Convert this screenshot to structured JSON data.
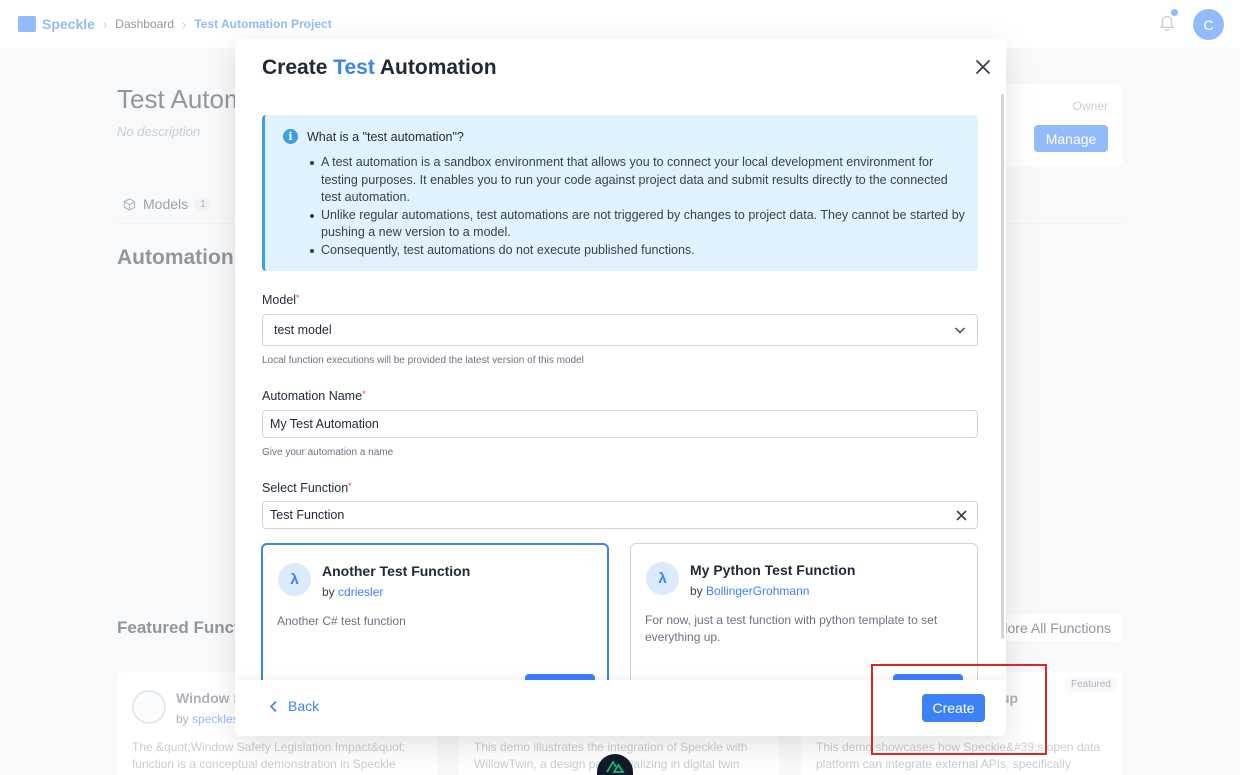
{
  "topbar": {
    "brand": "Speckle",
    "breadcrumb": [
      "Dashboard",
      "Test Automation Project"
    ],
    "avatar_initial": "C"
  },
  "page": {
    "title": "Test Autom",
    "description": "No description",
    "owner_label": "Owner",
    "manage_label": "Manage",
    "tab_models": "Models",
    "tab_models_count": "1",
    "automations_heading": "Automation",
    "featured_heading": "Featured Funct",
    "explore_label": "lore All Functions",
    "featured_cards": [
      {
        "title": "Window S",
        "by_prefix": "by",
        "author": "speckles",
        "desc": "The &quot;Window Safety Legislation Impact&quot; function is a conceptual demonstration in Speckle"
      },
      {
        "title": "",
        "by_prefix": "",
        "author": "",
        "desc": "This demo illustrates the integration of Speckle with WillowTwin, a design pa  specializing in digital twin"
      },
      {
        "title": "up",
        "by_prefix": "",
        "author": "",
        "desc": "This demo showcases how Speckle&#39;s open data platform can integrate external APIs, specifically",
        "badge": "Featured"
      }
    ]
  },
  "dialog": {
    "title_before": "Create ",
    "title_highlight": "Test",
    "title_after": " Automation",
    "info": {
      "title": "What is a \"test automation\"?",
      "items": [
        "A test automation is a sandbox environment that allows you to connect your local development environment for testing purposes. It enables you to run your code against project data and submit results directly to the connected test automation.",
        "Unlike regular automations, test automations are not triggered by changes to project data. They cannot be started by pushing a new version to a model.",
        "Consequently, test automations do not execute published functions."
      ]
    },
    "model": {
      "label": "Model",
      "value": "test model",
      "help": "Local function executions will be provided the latest version of this model"
    },
    "automation_name": {
      "label": "Automation Name",
      "value": "My Test Automation",
      "help": "Give your automation a name"
    },
    "select_function": {
      "label": "Select Function",
      "value": "Test Function"
    },
    "functions": [
      {
        "icon": "λ",
        "title": "Another Test Function",
        "by_prefix": "by",
        "author": "cdriesler",
        "desc": "Another C# test function",
        "selected": true
      },
      {
        "icon": "λ",
        "title": "My Python Test Function",
        "by_prefix": "by",
        "author": "BollingerGrohmann",
        "desc": "For now, just a test function with python template to set everything up.",
        "selected": false
      }
    ],
    "back_label": "Back",
    "create_label": "Create"
  },
  "colors": {
    "accent": "#3b82f6",
    "info_bg": "#e0f2fe",
    "highlight": "#dc2626"
  }
}
